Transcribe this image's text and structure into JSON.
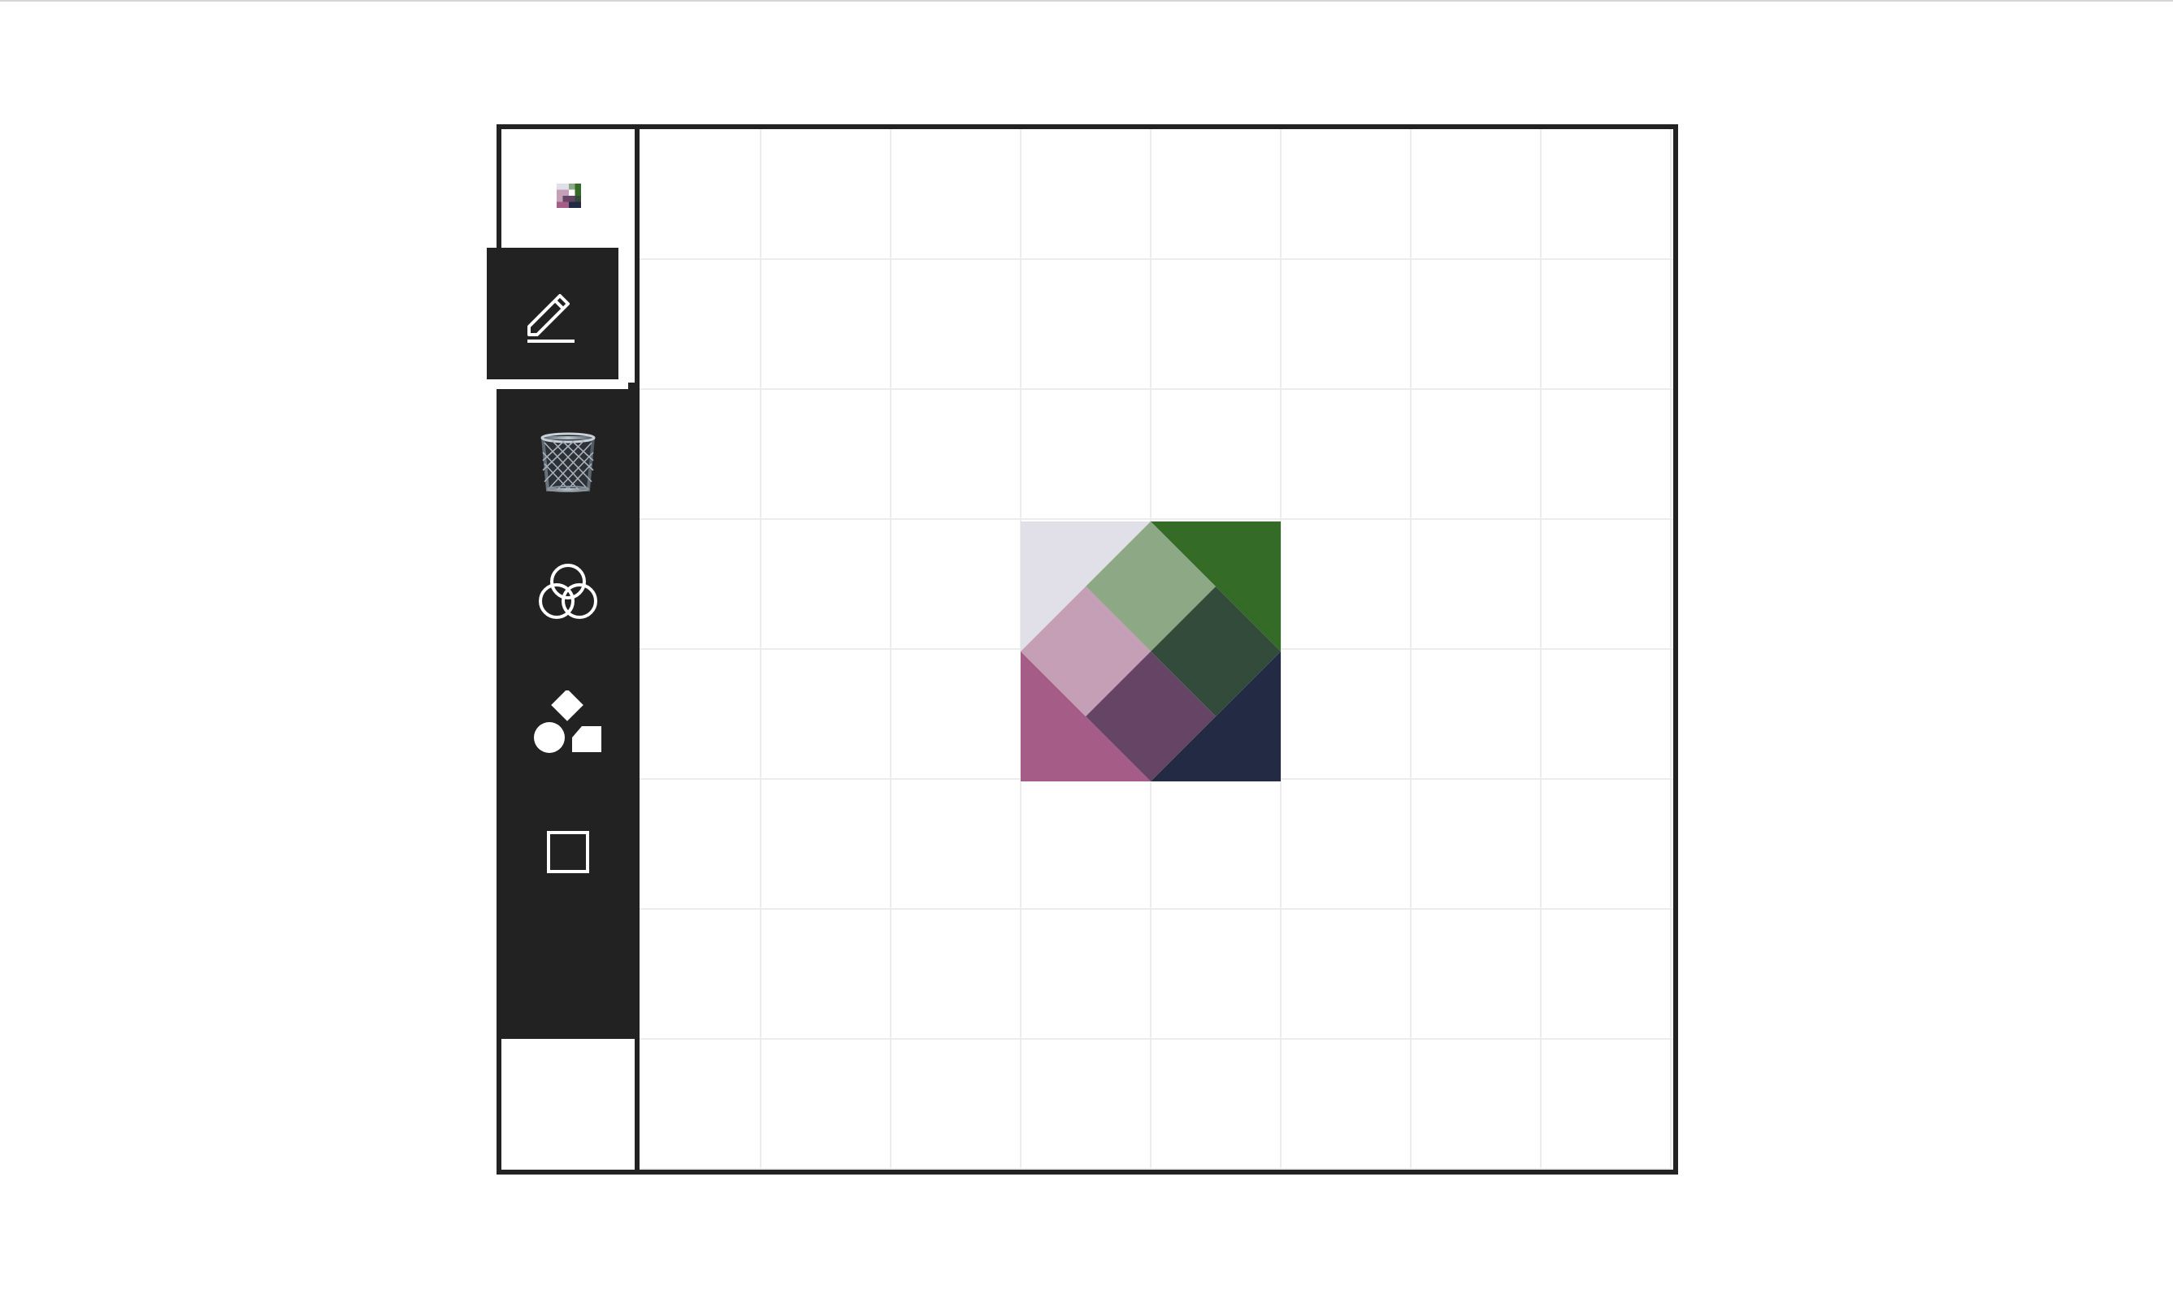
{
  "toolbar": {
    "logo_icon": "pixel-palette-logo-icon",
    "tools": [
      {
        "id": "pen",
        "icon": "pencil-icon",
        "selected": true
      },
      {
        "id": "trash",
        "icon": "wastebasket-icon",
        "selected": false
      },
      {
        "id": "blend",
        "icon": "overlapping-circles-icon",
        "selected": false
      },
      {
        "id": "shapes",
        "icon": "shapes-icon",
        "selected": false
      },
      {
        "id": "square",
        "icon": "square-outline-icon",
        "selected": false
      }
    ]
  },
  "canvas": {
    "grid_columns": 8,
    "grid_rows": 8,
    "grid_color": "#ececec",
    "frame_color": "#222222",
    "swatch": {
      "description_colors": {
        "lavender": "#e1dfe8",
        "sage": "#8da884",
        "forest_green": "#336b27",
        "mauve_light": "#c49fb6",
        "dark_green": "#324b3a",
        "pink": "#a55d88",
        "plum": "#664466",
        "navy": "#232a44"
      }
    }
  }
}
